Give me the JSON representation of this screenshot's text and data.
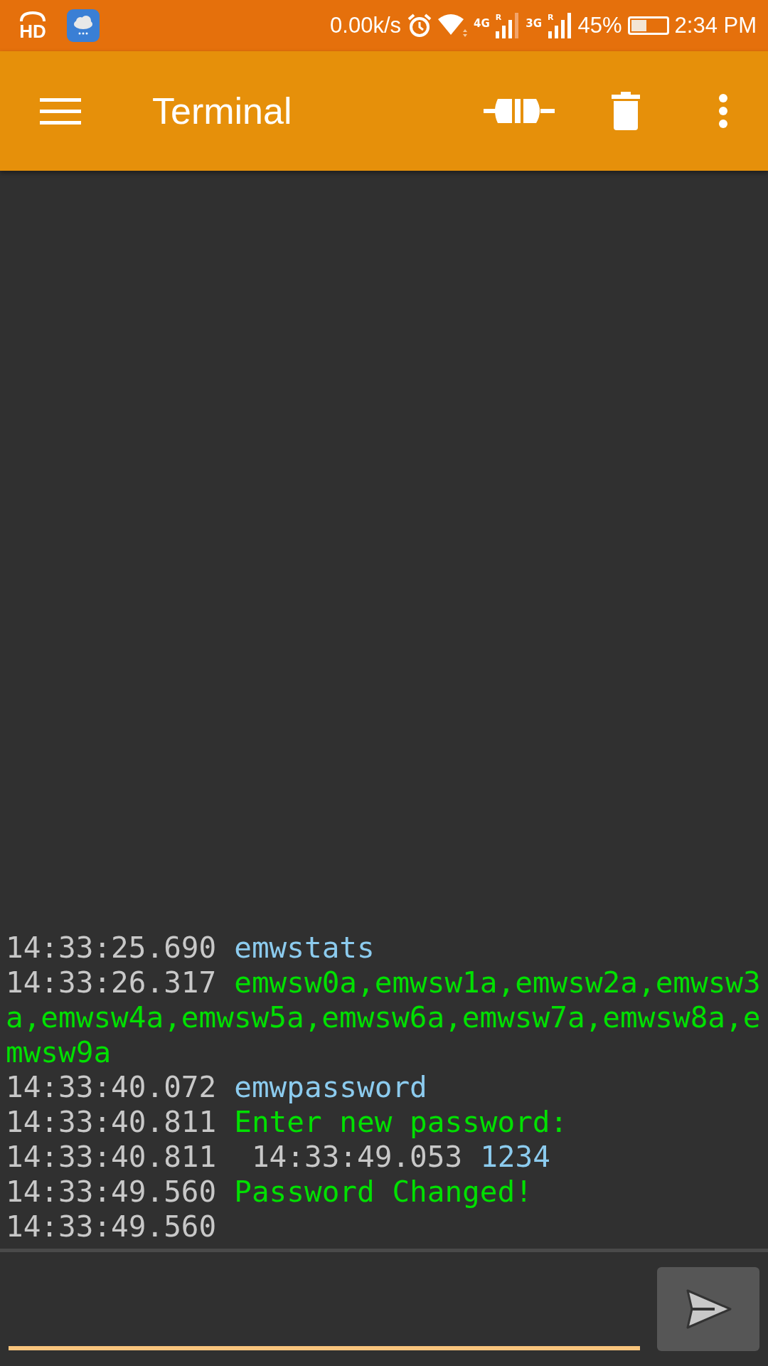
{
  "status_bar": {
    "hd_label": "HD",
    "speed": "0.00k/s",
    "network_1": "4G",
    "roaming_1": "R",
    "network_2": "3G",
    "roaming_2": "R",
    "battery": "45%",
    "time": "2:34 PM"
  },
  "toolbar": {
    "title": "Terminal"
  },
  "terminal": {
    "lines": [
      {
        "segments": [
          {
            "kind": "time",
            "text": "14:33:25.690"
          },
          {
            "kind": "sent",
            "text": "emwstats"
          }
        ]
      },
      {
        "segments": [
          {
            "kind": "time",
            "text": "14:33:26.317"
          },
          {
            "kind": "received",
            "text": "emwsw0a,emwsw1a,emwsw2a,emwsw3a,emwsw4a,emwsw5a,emwsw6a,emwsw7a,emwsw8a,emwsw9a"
          }
        ]
      },
      {
        "segments": [
          {
            "kind": "time",
            "text": "14:33:40.072"
          },
          {
            "kind": "sent",
            "text": "emwpassword"
          }
        ]
      },
      {
        "segments": [
          {
            "kind": "time",
            "text": "14:33:40.811"
          },
          {
            "kind": "received",
            "text": "Enter new password:"
          }
        ]
      },
      {
        "segments": [
          {
            "kind": "time",
            "text": "14:33:40.811"
          },
          {
            "kind": "time",
            "text": " 14:33:49.053"
          },
          {
            "kind": "sent",
            "text": "1234"
          }
        ]
      },
      {
        "segments": [
          {
            "kind": "time",
            "text": "14:33:49.560"
          },
          {
            "kind": "received",
            "text": "Password Changed!"
          }
        ]
      },
      {
        "segments": [
          {
            "kind": "time",
            "text": "14:33:49.560"
          }
        ]
      }
    ]
  }
}
